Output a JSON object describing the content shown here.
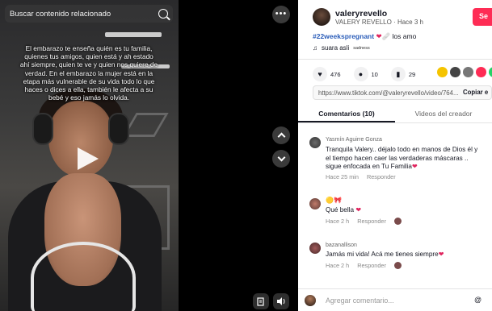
{
  "video": {
    "search_placeholder": "Buscar contenido relacionado",
    "caption": "El embarazo te enseña quién es tu familia, quienes tus amigos, quien está y ah estado ahí siempre, quien te ve y quien nos quiere de verdad. En el embarazo la mujer está en la etapa más vulnerable de su vida todo lo que haces o dices a ella, también le afecta a su bebé y eso jamás lo olvida."
  },
  "controls": {
    "more_icon": "more-horizontal-icon",
    "prev_icon": "chevron-up-icon",
    "next_icon": "chevron-down-icon",
    "bottom_icons": [
      "report-flag-icon",
      "volume-icon"
    ]
  },
  "post": {
    "username": "valeryrevello",
    "display_name": "VALERY REVELLO",
    "time": "Hace 3 h",
    "follow_label": "Se",
    "hashtag": "#22weekspregnant",
    "desc_rest": "los amo",
    "music_text": "suara asli",
    "music_sub": "sadness"
  },
  "stats": {
    "likes": "476",
    "comments": "10",
    "saves": "29"
  },
  "share": {
    "colors": [
      "#f5c400",
      "#444444",
      "#777777",
      "#fe2c55",
      "#25d366"
    ]
  },
  "link": {
    "url": "https://www.tiktok.com/@valeryrevello/video/764...",
    "copy_label": "Copiar e"
  },
  "tabs": {
    "comments": "Comentarios (10)",
    "creator_videos": "Videos del creador"
  },
  "comments": [
    {
      "name": "Yasmín Aguirre Gonza",
      "text": "Tranquila Valery.. déjalo todo en manos de Dios él y el tiempo hacen caer las verdaderas máscaras .. sigue enfocada en Tu Familia",
      "time": "Hace 25 min",
      "reply": "Responder"
    },
    {
      "name": "",
      "text": "Qué bella",
      "time": "Hace 2 h",
      "reply": "Responder"
    },
    {
      "name": "bazanallison",
      "text": "Jamás mi vida! Acá me tienes siempre",
      "time": "Hace 2 h",
      "reply": "Responder"
    }
  ],
  "composer": {
    "placeholder": "Agregar comentario..."
  }
}
